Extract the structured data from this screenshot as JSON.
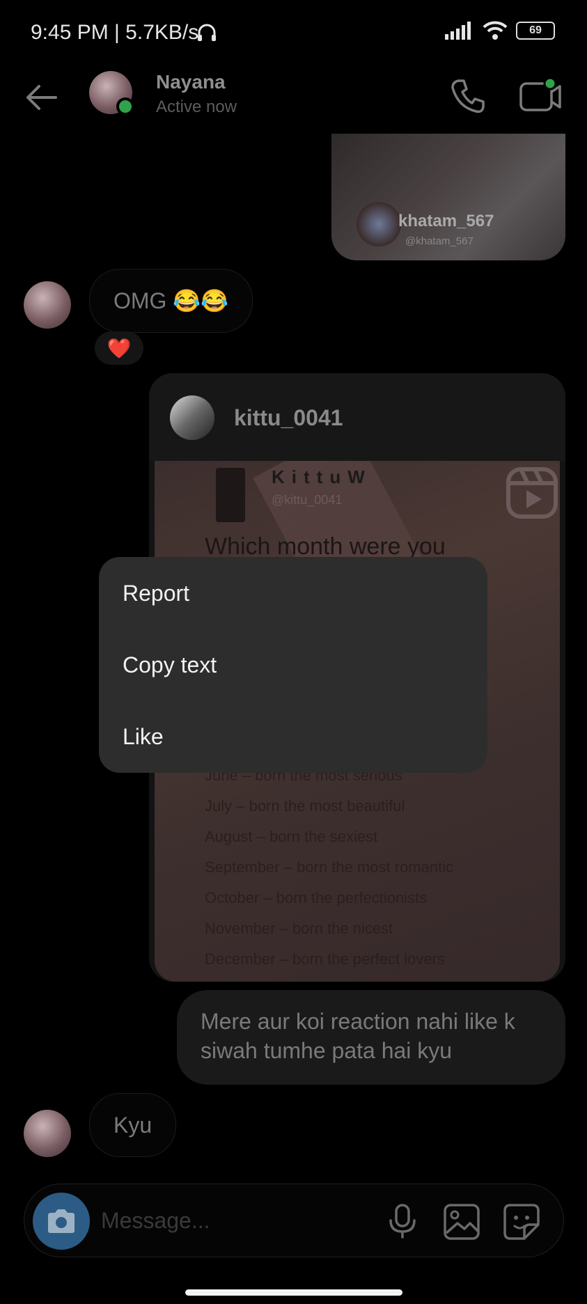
{
  "status_bar": {
    "time_speed": "9:45 PM | 5.7KB/s",
    "battery": "69"
  },
  "header": {
    "contact_name": "Nayana",
    "contact_status": "Active now",
    "icons": [
      "back-arrow-icon",
      "phone-icon",
      "video-camera-icon"
    ]
  },
  "thread": {
    "shared_post": {
      "handle": "khatam_567",
      "handle_small": "@khatam_567"
    },
    "msg_omg": "OMG 😂😂",
    "reaction": "❤️",
    "reel": {
      "username": "kittu_0041",
      "brand": "KittuW",
      "handle": "@kittu_0041",
      "headline": "Which month were you",
      "lines": [
        "June – born the most serious",
        "July – born the most beautiful",
        "August – born the  sexiest",
        "September – born the most romantic",
        "October – born the perfectionists",
        "November – born the nicest",
        "December – born the perfect lovers"
      ]
    },
    "msg_outgoing": "Mere aur koi reaction nahi like k siwah tumhe pata hai kyu",
    "msg_kyu": "Kyu"
  },
  "composer": {
    "placeholder": "Message...",
    "icons": [
      "camera-icon",
      "microphone-icon",
      "gallery-icon",
      "sticker-icon"
    ]
  },
  "context_menu": {
    "items": [
      "Report",
      "Copy text",
      "Like"
    ]
  }
}
